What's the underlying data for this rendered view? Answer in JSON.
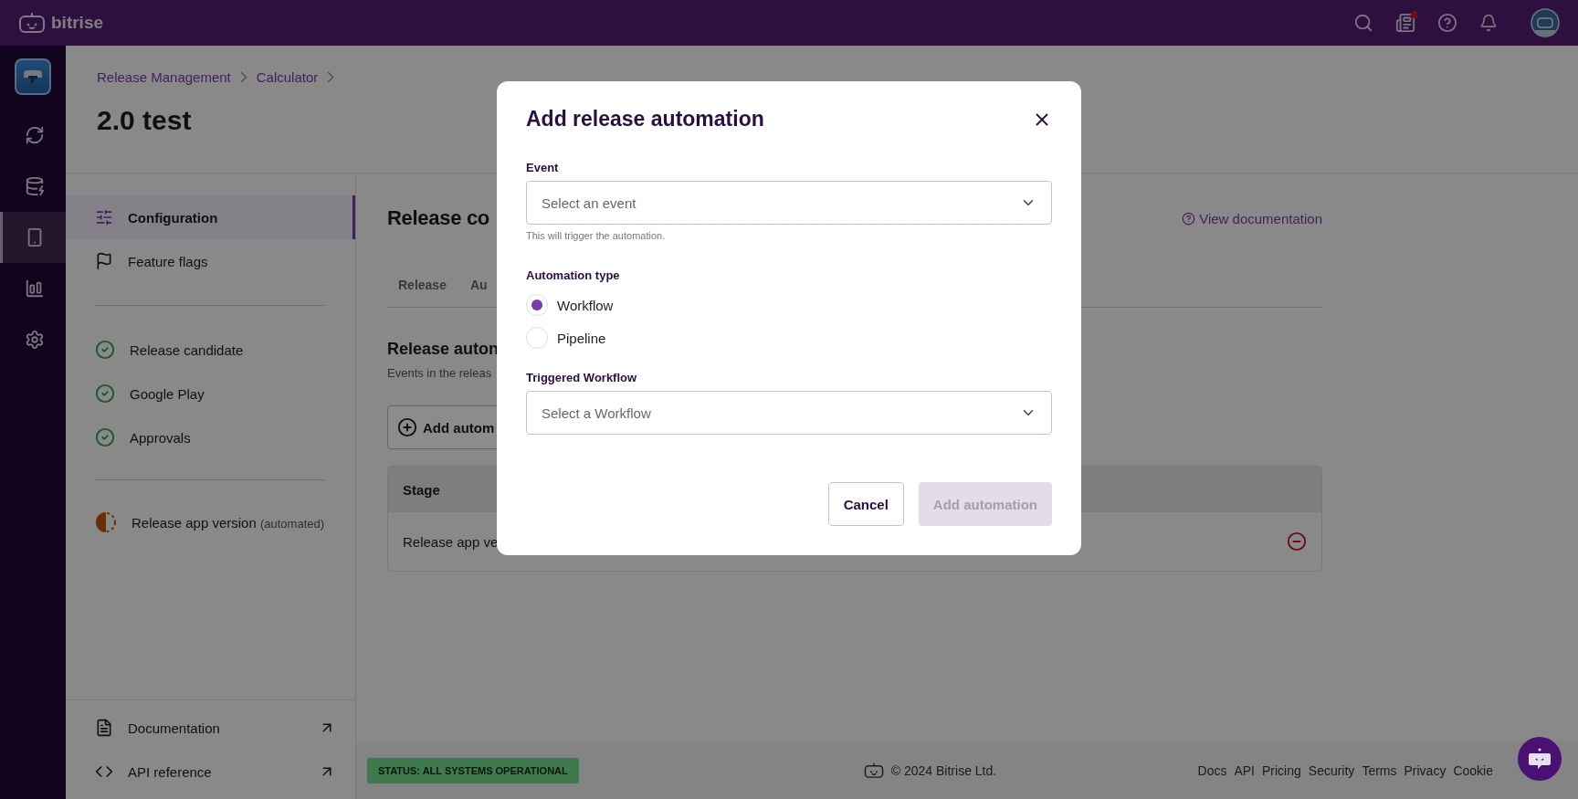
{
  "topbar": {
    "brand": "bitrise",
    "news_unread": true
  },
  "rail": [
    {
      "kind": "app",
      "selected": false
    },
    {
      "kind": "builds",
      "selected": false
    },
    {
      "kind": "cache",
      "selected": false
    },
    {
      "kind": "release",
      "selected": true
    },
    {
      "kind": "insights",
      "selected": false
    },
    {
      "kind": "settings",
      "selected": false
    }
  ],
  "breadcrumb": [
    "Release Management",
    "Calculator"
  ],
  "title": "2.0 test",
  "sidebar": {
    "nav": [
      {
        "label": "Configuration",
        "kind": "settings",
        "selected": true
      },
      {
        "label": "Feature flags",
        "kind": "flag",
        "selected": false
      }
    ],
    "stages": [
      {
        "label": "Release candidate",
        "kind": "done"
      },
      {
        "label": "Google Play",
        "kind": "done"
      },
      {
        "label": "Approvals",
        "kind": "done"
      },
      {
        "label": "Release app version",
        "note": "(automated)",
        "kind": "in_progress"
      }
    ],
    "links": [
      {
        "label": "Documentation",
        "kind": "doc"
      },
      {
        "label": "API reference",
        "kind": "code"
      }
    ]
  },
  "main": {
    "heading": "Release co",
    "doc_link": "View documentation",
    "tabs": [
      {
        "label": "Release",
        "selected": false
      },
      {
        "label": "Au",
        "selected": false
      }
    ],
    "section_title": "Release auton",
    "section_description": "Events in the releas",
    "add_button": "Add autom",
    "table": {
      "columns": [
        "Stage"
      ],
      "rows": [
        {
          "stage": "Release app ve"
        }
      ]
    }
  },
  "footer": {
    "status": "STATUS: ALL SYSTEMS OPERATIONAL",
    "copyright": "© 2024 Bitrise Ltd.",
    "links": [
      "Docs",
      "API",
      "Pricing",
      "Security",
      "Terms",
      "Privacy",
      "Cookie"
    ]
  },
  "modal": {
    "title": "Add release automation",
    "event": {
      "label": "Event",
      "placeholder": "Select an event",
      "hint": "This will trigger the automation."
    },
    "automation_type": {
      "label": "Automation type",
      "options": [
        {
          "label": "Workflow",
          "selected": true
        },
        {
          "label": "Pipeline",
          "selected": false
        }
      ]
    },
    "triggered": {
      "label": "Triggered Workflow",
      "placeholder": "Select a Workflow"
    },
    "buttons": [
      {
        "label": "Cancel",
        "kind": "secondary",
        "disabled": false
      },
      {
        "label": "Add automation",
        "kind": "primary",
        "disabled": true
      }
    ]
  }
}
